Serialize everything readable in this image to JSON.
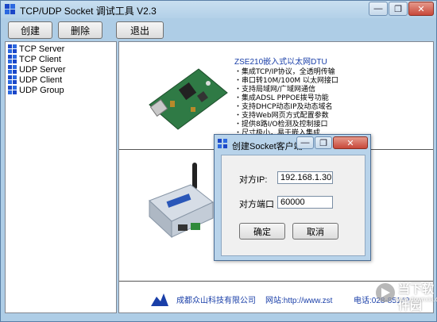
{
  "window": {
    "title": "TCP/UDP Socket 调试工具 V2.3",
    "minimize_glyph": "—",
    "restore_glyph": "❐",
    "close_glyph": "✕"
  },
  "toolbar": {
    "create_label": "创建",
    "delete_label": "删除",
    "exit_label": "退出"
  },
  "tree": {
    "items": [
      {
        "label": "TCP Server"
      },
      {
        "label": "TCP Client"
      },
      {
        "label": "UDP Server"
      },
      {
        "label": "UDP Client"
      },
      {
        "label": "UDP Group"
      }
    ]
  },
  "ad": {
    "dtu_title": "ZSE210嵌入式以太网DTU",
    "features": [
      "・集成TCP/IP协议，全透明传输",
      "・串口转10M/100M 以太网接口",
      "・支持局域网/广域网通信",
      "・集成ADSL PPPOE拨号功能",
      "・支持DHCP动态IP及动态域名",
      "・支持Web网页方式配置参数",
      "・提供8路I/O检测及控制接口",
      "・尺寸极小，易于嵌入集成"
    ],
    "company": "成都众山科技有限公司",
    "website": "网站:http://www.zst",
    "phone": "电话:028-85142"
  },
  "dialog": {
    "title": "创建Socket客户端",
    "ip_label": "对方IP:",
    "ip_value": "192.168.1.30",
    "port_label": "对方端口",
    "port_value": "60000",
    "ok_label": "确定",
    "cancel_label": "取消"
  },
  "watermark": {
    "text": "当下软件园",
    "url": "www.downxia.com"
  },
  "colors": {
    "accent": "#1a3fa8",
    "titlebar": "#b3d0e8"
  }
}
